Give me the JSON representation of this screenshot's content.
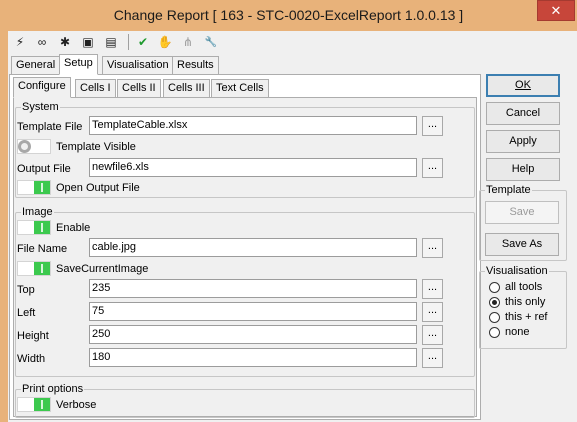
{
  "window": {
    "title": "Change Report [ 163 - STC-0020-ExcelReport 1.0.0.13 ]",
    "close_glyph": "✕"
  },
  "toolbar": {
    "icons": [
      {
        "name": "lightning-icon",
        "glyph": "⚡"
      },
      {
        "name": "link-icon",
        "glyph": "∞"
      },
      {
        "name": "puzzle-icon",
        "glyph": "✱"
      },
      {
        "name": "console-icon",
        "glyph": "▣"
      },
      {
        "name": "notes-icon",
        "glyph": "▤"
      },
      {
        "name": "checkmark-icon",
        "glyph": "✔"
      },
      {
        "name": "hand-icon",
        "glyph": "✋"
      },
      {
        "name": "network-icon",
        "glyph": "⋔"
      },
      {
        "name": "wrench-icon",
        "glyph": "🔧"
      }
    ]
  },
  "tabs": [
    "General",
    "Setup",
    "Visualisation",
    "Results"
  ],
  "subtabs": [
    "Configure",
    "Cells I",
    "Cells II",
    "Cells III",
    "Text Cells"
  ],
  "system": {
    "title": "System",
    "template_file_label": "Template File",
    "template_file_value": "TemplateCable.xlsx",
    "template_visible_label": "Template Visible",
    "output_file_label": "Output File",
    "output_file_value": "newfile6.xls",
    "open_output_label": "Open Output File"
  },
  "image": {
    "title": "Image",
    "enable_label": "Enable",
    "file_name_label": "File Name",
    "file_name_value": "cable.jpg",
    "save_current_label": "SaveCurrentImage",
    "top_label": "Top",
    "top_value": "235",
    "left_label": "Left",
    "left_value": "75",
    "height_label": "Height",
    "height_value": "250",
    "width_label": "Width",
    "width_value": "180"
  },
  "print": {
    "title": "Print options",
    "verbose_label": "Verbose"
  },
  "browse_label": "...",
  "buttons": {
    "ok": "OK",
    "cancel": "Cancel",
    "apply": "Apply",
    "help": "Help"
  },
  "template_group": {
    "title": "Template",
    "save": "Save",
    "save_as": "Save As"
  },
  "visualisation_group": {
    "title": "Visualisation",
    "options": [
      "all tools",
      "this only",
      "this + ref",
      "none"
    ],
    "selected": "this only"
  },
  "colors": {
    "toggle_on": "#3cc94e",
    "toggle_off": "#a8a8a8",
    "title_bar": "#e8b27a",
    "close": "#c7463a"
  }
}
